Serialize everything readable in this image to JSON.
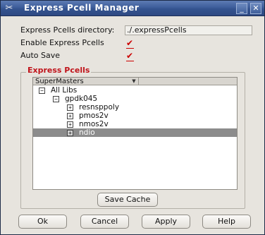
{
  "window": {
    "title": "Express Pcell Manager",
    "minimize_glyph": "_",
    "close_glyph": "✕",
    "app_icon": "scissors-icon"
  },
  "settings": {
    "dir_label": "Express Pcells directory:",
    "dir_value": "./.expressPcells",
    "enable_label": "Enable Express Pcells",
    "enable_checked": true,
    "autosave_label": "Auto Save",
    "autosave_checked": true,
    "check_glyph": "✔"
  },
  "group": {
    "title": "Express Pcells",
    "combo_value": "SuperMasters",
    "combo_arrow": "▼",
    "tree": [
      {
        "toggle": "−",
        "label": "All Libs"
      },
      {
        "toggle": "−",
        "label": "gpdk045"
      },
      {
        "toggle": "+",
        "label": "resnsppoly"
      },
      {
        "toggle": "+",
        "label": "pmos2v"
      },
      {
        "toggle": "+",
        "label": "nmos2v"
      },
      {
        "toggle": "+",
        "label": "ndio",
        "selected": true
      }
    ],
    "save_cache_label": "Save Cache"
  },
  "buttons": {
    "ok": "Ok",
    "cancel": "Cancel",
    "apply": "Apply",
    "help": "Help"
  },
  "colors": {
    "titlebar": "#3e5e9b",
    "group_title": "#c0141b",
    "checkmark": "#cc0000",
    "selection": "#8c8c8c"
  }
}
